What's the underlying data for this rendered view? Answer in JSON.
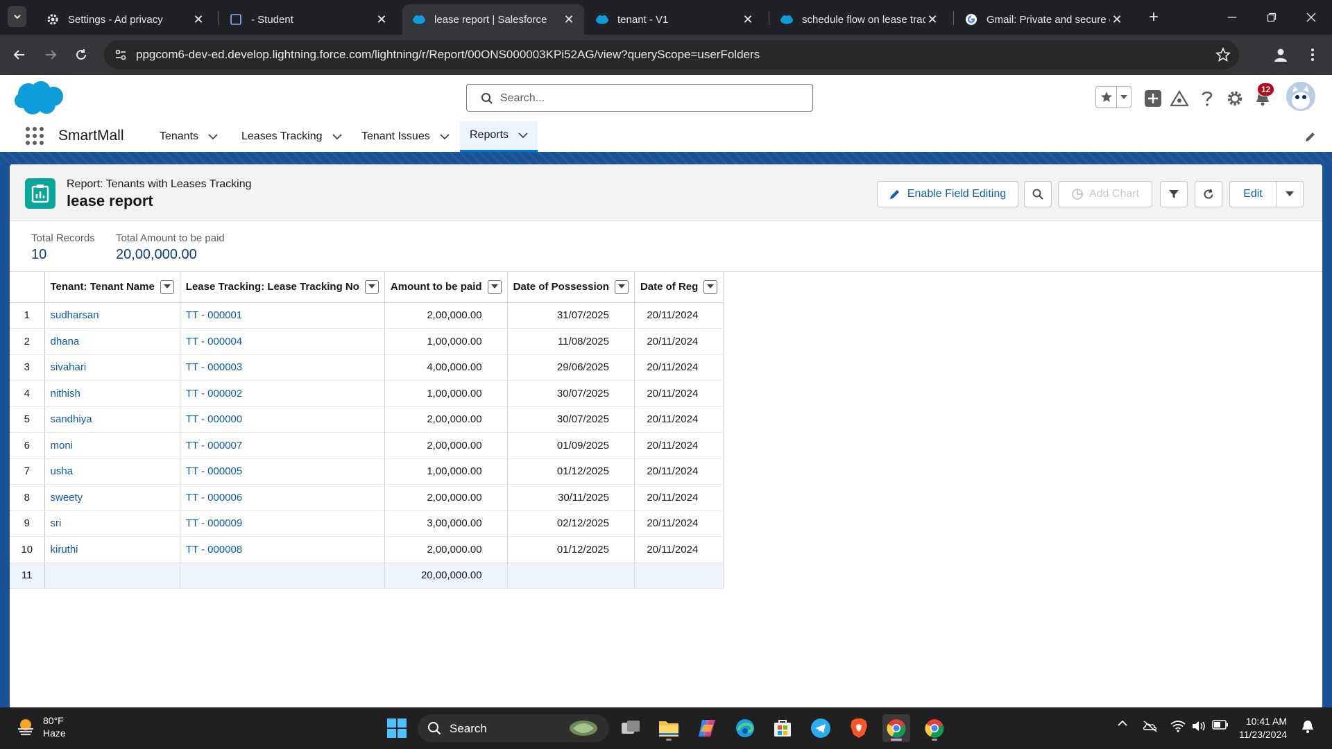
{
  "browser": {
    "tabs": [
      {
        "title": "Settings - Ad privacy",
        "icon": "settings-gear-icon"
      },
      {
        "title": "- Student",
        "icon": "page-icon"
      },
      {
        "title": "lease report | Salesforce",
        "icon": "salesforce-cloud-icon",
        "active": true
      },
      {
        "title": "tenant - V1",
        "icon": "salesforce-cloud-icon"
      },
      {
        "title": "schedule flow on lease trac",
        "icon": "salesforce-cloud-icon"
      },
      {
        "title": "Gmail: Private and secure e",
        "icon": "google-icon"
      }
    ],
    "url": "ppgcom6-dev-ed.develop.lightning.force.com/lightning/r/Report/00ONS000003KPi52AG/view?queryScope=userFolders"
  },
  "sf": {
    "search_placeholder": "Search...",
    "notifications_count": "12",
    "app_name": "SmartMall",
    "nav": [
      "Tenants",
      "Leases Tracking",
      "Tenant Issues",
      "Reports"
    ],
    "nav_active": "Reports"
  },
  "report": {
    "type_label": "Report: Tenants with Leases Tracking",
    "title": "lease report",
    "buttons": {
      "enable_field_editing": "Enable Field Editing",
      "add_chart": "Add Chart",
      "edit": "Edit"
    },
    "summary": {
      "total_records_label": "Total Records",
      "total_records_value": "10",
      "total_amount_label": "Total Amount to be paid",
      "total_amount_value": "20,00,000.00"
    },
    "columns": [
      "Tenant: Tenant Name",
      "Lease Tracking: Lease Tracking No",
      "Amount to be paid",
      "Date of Possession",
      "Date of Reg"
    ],
    "rows": [
      {
        "n": "1",
        "tenant": "sudharsan",
        "lease": "TT - 000001",
        "amount": "2,00,000.00",
        "possession": "31/07/2025",
        "reg": "20/11/2024"
      },
      {
        "n": "2",
        "tenant": "dhana",
        "lease": "TT - 000004",
        "amount": "1,00,000.00",
        "possession": "11/08/2025",
        "reg": "20/11/2024"
      },
      {
        "n": "3",
        "tenant": "sivahari",
        "lease": "TT - 000003",
        "amount": "4,00,000.00",
        "possession": "29/06/2025",
        "reg": "20/11/2024"
      },
      {
        "n": "4",
        "tenant": "nithish",
        "lease": "TT - 000002",
        "amount": "1,00,000.00",
        "possession": "30/07/2025",
        "reg": "20/11/2024"
      },
      {
        "n": "5",
        "tenant": "sandhiya",
        "lease": "TT - 000000",
        "amount": "2,00,000.00",
        "possession": "30/07/2025",
        "reg": "20/11/2024"
      },
      {
        "n": "6",
        "tenant": "moni",
        "lease": "TT - 000007",
        "amount": "2,00,000.00",
        "possession": "01/09/2025",
        "reg": "20/11/2024"
      },
      {
        "n": "7",
        "tenant": "usha",
        "lease": "TT - 000005",
        "amount": "1,00,000.00",
        "possession": "01/12/2025",
        "reg": "20/11/2024"
      },
      {
        "n": "8",
        "tenant": "sweety",
        "lease": "TT - 000006",
        "amount": "2,00,000.00",
        "possession": "30/11/2025",
        "reg": "20/11/2024"
      },
      {
        "n": "9",
        "tenant": "sri",
        "lease": "TT - 000009",
        "amount": "3,00,000.00",
        "possession": "02/12/2025",
        "reg": "20/11/2024"
      },
      {
        "n": "10",
        "tenant": "kiruthi",
        "lease": "TT - 000008",
        "amount": "2,00,000.00",
        "possession": "01/12/2025",
        "reg": "20/11/2024"
      }
    ],
    "total_row": {
      "n": "11",
      "amount": "20,00,000.00"
    }
  },
  "taskbar": {
    "weather_temp": "80°F",
    "weather_desc": "Haze",
    "search_placeholder": "Search",
    "time": "10:41 AM",
    "date": "11/23/2024"
  },
  "colors": {
    "sf_blue": "#0176d3",
    "link": "#0b5cab",
    "banner": "#1b5297",
    "report_icon": "#07a59a",
    "badge": "#ba0517"
  }
}
